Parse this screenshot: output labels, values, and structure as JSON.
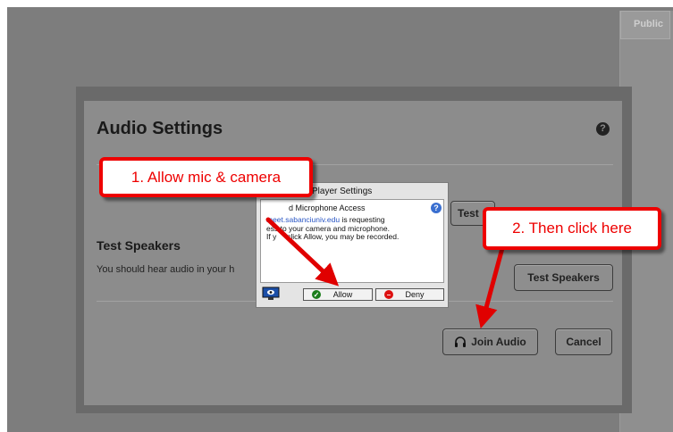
{
  "backdrop": {
    "public_tab_label": "Public"
  },
  "dialog": {
    "title": "Audio Settings",
    "help_icon_glyph": "?",
    "test_microphone_button_label": "Test",
    "test_speakers_heading": "Test Speakers",
    "test_speakers_description": "You should hear audio in your h",
    "test_speakers_button_label": "Test Speakers",
    "join_audio_button_label": "Join Audio",
    "cancel_button_label": "Cancel"
  },
  "flash_settings": {
    "title": "Player Settings",
    "heading": "d Microphone Access",
    "domain": "meet.sabanciuniv.edu",
    "body_line1_suffix": " is requesting",
    "body_line2": "ess to your camera and microphone.",
    "body_line3": "If y     click Allow, you may be recorded.",
    "allow_label": "Allow",
    "deny_label": "Deny"
  },
  "annotations": {
    "callout_1": "1. Allow mic & camera",
    "callout_2": "2. Then click here"
  },
  "colors": {
    "annotation_red": "#e00000",
    "flash_link_blue": "#2a56c4"
  },
  "icons": {
    "help": "help-icon",
    "headset": "headset-icon",
    "flash_info": "info-icon",
    "flash_settings": "monitor-settings-icon",
    "allow": "checkmark-icon",
    "deny": "deny-icon"
  }
}
